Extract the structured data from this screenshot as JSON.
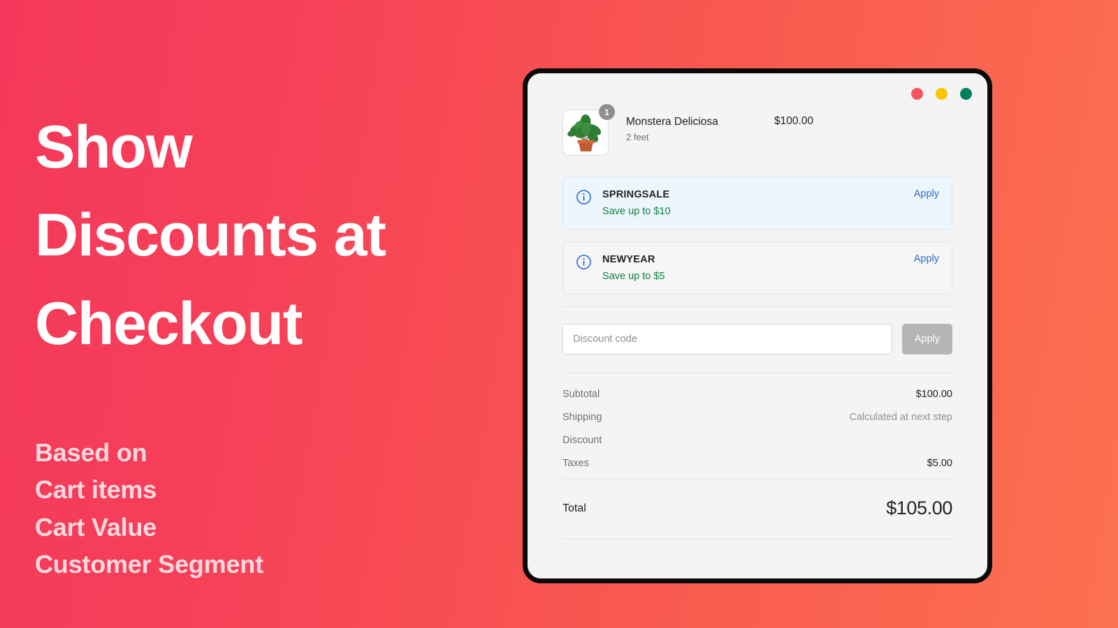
{
  "hero": {
    "headline_lines": [
      "Show",
      "Discounts at",
      "Checkout"
    ],
    "subpoints": [
      "Based on",
      "Cart items",
      "Cart Value",
      "Customer Segment"
    ],
    "colors": {
      "gradient_start": "#f4385b",
      "gradient_end": "#fb7150",
      "headline_color": "#ffffff",
      "subpoint_color": "#ffd9dd"
    }
  },
  "window": {
    "traffic_lights": [
      {
        "name": "close",
        "color": "#f9545e"
      },
      {
        "name": "minimize",
        "color": "#fdc500"
      },
      {
        "name": "maximize",
        "color": "#008060"
      }
    ],
    "background": "#f4f4f4"
  },
  "cart": {
    "item": {
      "quantity_badge": "1",
      "title": "Monstera Deliciosa",
      "variant": "2 feet",
      "price": "$100.00",
      "image_icon": "potted-plant-icon"
    }
  },
  "discounts": [
    {
      "icon": "info-circle-icon",
      "code": "SPRINGSALE",
      "savings": "Save up to $10",
      "action_label": "Apply",
      "highlighted": true
    },
    {
      "icon": "info-circle-icon",
      "code": "NEWYEAR",
      "savings": "Save up to $5",
      "action_label": "Apply",
      "highlighted": false
    }
  ],
  "code_entry": {
    "placeholder": "Discount code",
    "value": "",
    "apply_label": "Apply"
  },
  "summary": {
    "rows": [
      {
        "label": "Subtotal",
        "value": "$100.00",
        "muted": false
      },
      {
        "label": "Shipping",
        "value": "Calculated at next step",
        "muted": true
      },
      {
        "label": "Discount",
        "value": "",
        "muted": false
      },
      {
        "label": "Taxes",
        "value": "$5.00",
        "muted": false
      }
    ],
    "total": {
      "label": "Total",
      "value": "$105.00"
    }
  },
  "accent_colors": {
    "link_blue": "#2c6ecb",
    "savings_green": "#108043",
    "info_blue": "#2c6ecb",
    "highlight_card_bg": "#eef6fd",
    "apply_button_bg": "#b5b5b5"
  }
}
